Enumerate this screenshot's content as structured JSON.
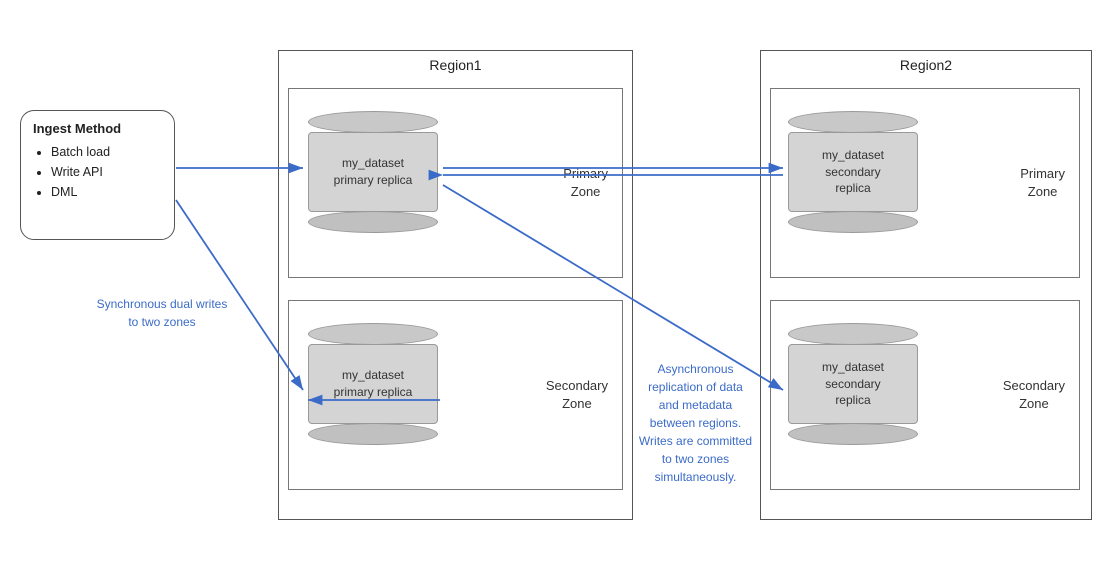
{
  "ingest": {
    "title": "Ingest Method",
    "items": [
      "Batch load",
      "Write API",
      "DML"
    ]
  },
  "region1": {
    "label": "Region1",
    "primaryZone": {
      "label": "Primary\nZone",
      "cylinder": {
        "line1": "my_dataset",
        "line2": "primary replica"
      }
    },
    "secondaryZone": {
      "label": "Secondary\nZone",
      "cylinder": {
        "line1": "my_dataset",
        "line2": "primary replica"
      }
    }
  },
  "region2": {
    "label": "Region2",
    "primaryZone": {
      "label": "Primary\nZone",
      "cylinder": {
        "line1": "my_dataset",
        "line2": "secondary",
        "line3": "replica"
      }
    },
    "secondaryZone": {
      "label": "Secondary\nZone",
      "cylinder": {
        "line1": "my_dataset",
        "line2": "secondary",
        "line3": "replica"
      }
    }
  },
  "annotations": {
    "sync": "Synchronous dual writes\nto two zones",
    "async": "Asynchronous\nreplication of data\nand metadata\nbetween regions.\nWrites are committed\nto two zones\nsimultaneously."
  },
  "arrowColor": "#3b6bc8"
}
